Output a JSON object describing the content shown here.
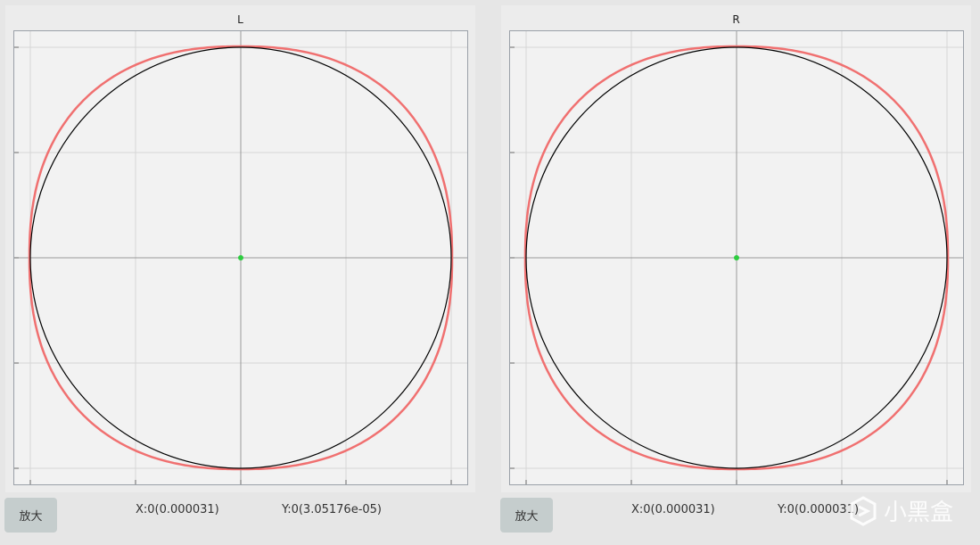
{
  "panels": [
    {
      "title": "L",
      "zoom_label": "放大",
      "x_readout": "X:0(0.000031)",
      "y_readout": "Y:0(3.05176e-05)",
      "center_point": {
        "x": 0,
        "y": 0
      }
    },
    {
      "title": "R",
      "zoom_label": "放大",
      "x_readout": "X:0(0.000031)",
      "y_readout": "Y:0(0.000031)",
      "center_point": {
        "x": 0,
        "y": 0
      }
    }
  ],
  "colors": {
    "reference_circle": "#000000",
    "measured_outline": "#f07070",
    "center_dot": "#2ecc40",
    "grid": "#d6d6d6",
    "axis": "#999999",
    "plot_bg": "#f2f2f2"
  },
  "watermark": {
    "text": "小黑盒",
    "icon": "heybox-logo-icon"
  }
}
